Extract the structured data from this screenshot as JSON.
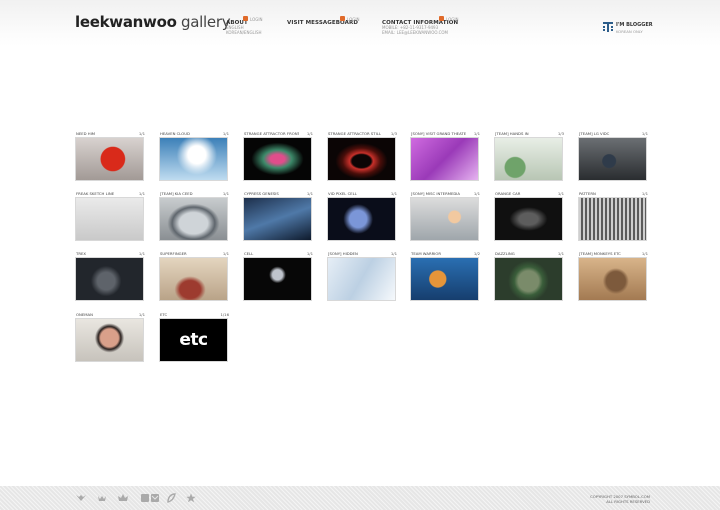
{
  "header": {
    "logo_bold": "leekwanwoo",
    "logo_light": " gallery",
    "nav": [
      {
        "label": "ABOUT",
        "badge": "LOGIN",
        "sub": [
          "ENGLISH",
          "KOREAN/ENGLISH"
        ]
      },
      {
        "label": "VISIT MESSAGEBOARD",
        "badge": "LOGIN",
        "sub": []
      },
      {
        "label": "CONTACT INFORMATION",
        "badge": "LOGIN",
        "sub": [
          "MOBILE: +82-11-9317-9493",
          "EMAIL: LEE@LEEKWANWOO.COM"
        ]
      }
    ],
    "blogger": {
      "label": "I'M BLOGGER",
      "sub": "KOREAN ONLY",
      "icon": "blogger-icon"
    }
  },
  "gallery": [
    {
      "title": "NEED HIM",
      "count": "1/1"
    },
    {
      "title": "HEAVEN CLOUD",
      "count": "1/1"
    },
    {
      "title": "STRANGE ATTRACTOR FRONT",
      "count": "1/1"
    },
    {
      "title": "STRANGE ATTRACTOR STILL",
      "count": "1/3"
    },
    {
      "title": "[SONY] VISIT GRAND THEATER",
      "count": "1/1"
    },
    {
      "title": "[TEAM] HANDS IN",
      "count": "1/3"
    },
    {
      "title": "[TEAM] LG VIDC",
      "count": "1/1"
    },
    {
      "title": "FREAK SKETCH LINE",
      "count": "1/1"
    },
    {
      "title": "[TEAM] KIA CEED",
      "count": "1/1"
    },
    {
      "title": "CYPRESS GENESIS",
      "count": "1/1"
    },
    {
      "title": "VID PIXEL CELL",
      "count": "1/1"
    },
    {
      "title": "[SONY] MISC INTERMEDIA",
      "count": "1/1"
    },
    {
      "title": "ORANGE CAR",
      "count": "1/1"
    },
    {
      "title": "PATTERN",
      "count": "1/1"
    },
    {
      "title": "TREX",
      "count": "1/1"
    },
    {
      "title": "SUPERFINGER",
      "count": "1/1"
    },
    {
      "title": "CELL",
      "count": "1/1"
    },
    {
      "title": "[SONY] HIDDEN",
      "count": "1/1"
    },
    {
      "title": "TEAM WARRIOR",
      "count": "1/2"
    },
    {
      "title": "DAZZLING",
      "count": "1/1"
    },
    {
      "title": "[TEAM] MONKEYS ETC",
      "count": "1/1"
    },
    {
      "title": "ONEMAN",
      "count": "1/1"
    },
    {
      "title": "ETC",
      "count": "1/16",
      "thumb_text": "etc"
    }
  ],
  "footer": {
    "icons": [
      "wing-icon",
      "heart-icon",
      "crown-icon",
      "mail-icon",
      "leaf-icon",
      "star-icon"
    ],
    "copyright": [
      "COPYRIGHT 2007 SYMBOL.COM",
      "ALL RIGHTS RESERVED"
    ]
  }
}
